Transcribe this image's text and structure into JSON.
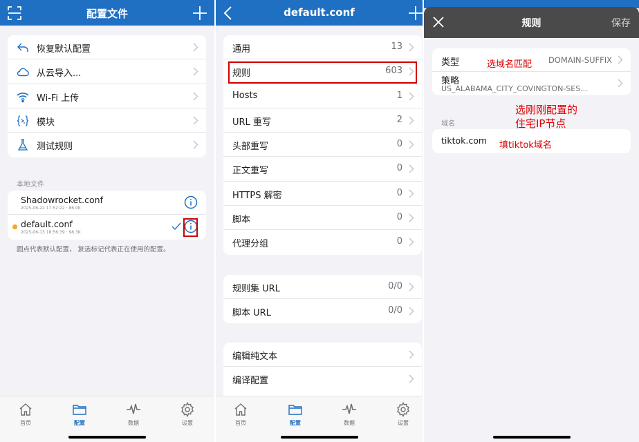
{
  "panel1": {
    "title": "配置文件",
    "menu": [
      {
        "label": "恢复默认配置",
        "icon": "undo-icon"
      },
      {
        "label": "从云导入...",
        "icon": "cloud-icon"
      },
      {
        "label": "Wi-Fi 上传",
        "icon": "wifi-icon"
      },
      {
        "label": "模块",
        "icon": "code-braces-icon"
      },
      {
        "label": "测试规则",
        "icon": "flask-icon"
      }
    ],
    "local_files_label": "本地文件",
    "files": [
      {
        "name": "Shadowrocket.conf",
        "meta": "2025-06-22 17:52:22 · 86.0K"
      },
      {
        "name": "default.conf",
        "meta": "2025-06-13 18:56:39 · 98.3K"
      }
    ],
    "footnote": "圆点代表默认配置， 复选标记代表正在使用的配置。"
  },
  "panel2": {
    "title": "default.conf",
    "group1": [
      {
        "label": "通用",
        "value": "13"
      },
      {
        "label": "规则",
        "value": "603"
      },
      {
        "label": "Hosts",
        "value": "1"
      },
      {
        "label": "URL 重写",
        "value": "2"
      },
      {
        "label": "头部重写",
        "value": "0"
      },
      {
        "label": "正文重写",
        "value": "0"
      },
      {
        "label": "HTTPS 解密",
        "value": "0"
      },
      {
        "label": "脚本",
        "value": "0"
      },
      {
        "label": "代理分组",
        "value": "0"
      }
    ],
    "group2": [
      {
        "label": "规则集 URL",
        "value": "0/0"
      },
      {
        "label": "脚本 URL",
        "value": "0/0"
      }
    ],
    "group3": [
      {
        "label": "编辑纯文本"
      },
      {
        "label": "编译配置"
      }
    ]
  },
  "panel3": {
    "title": "规则",
    "save_label": "保存",
    "type_label": "类型",
    "type_value": "DOMAIN-SUFFIX",
    "policy_label": "策略",
    "policy_value": "US_ALABAMA_CITY_COVINGTON-SES...",
    "domain_section_label": "域名",
    "domain_value": "tiktok.com"
  },
  "tabs": [
    {
      "label": "首页",
      "icon": "house-icon"
    },
    {
      "label": "配置",
      "icon": "folder-icon"
    },
    {
      "label": "数据",
      "icon": "pulse-icon"
    },
    {
      "label": "设置",
      "icon": "gear-icon"
    }
  ],
  "annotations": {
    "type_note": "选域名匹配",
    "policy_note_line1": "选刚刚配置的",
    "policy_note_line2": "住宅IP节点",
    "domain_note": "填tiktok域名"
  },
  "colors": {
    "nav_blue": "#1f6fc2",
    "dark_header": "#4a4a4a",
    "default_dot": "#f5a623",
    "annotation_red": "#e00000"
  }
}
